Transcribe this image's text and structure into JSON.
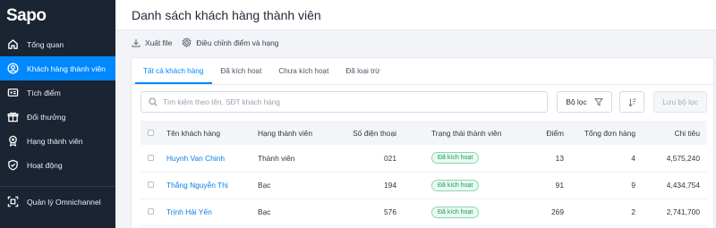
{
  "logo": {
    "text": "Sapo"
  },
  "sidebar": {
    "items": [
      {
        "label": "Tổng quan",
        "icon": "home-icon",
        "active": false
      },
      {
        "label": "Khách hàng thành viên",
        "icon": "user-circle-icon",
        "active": true
      },
      {
        "label": "Tích điểm",
        "icon": "card-icon",
        "active": false
      },
      {
        "label": "Đổi thưởng",
        "icon": "gift-icon",
        "active": false
      },
      {
        "label": "Hạng thành viên",
        "icon": "medal-icon",
        "active": false
      },
      {
        "label": "Hoạt động",
        "icon": "shield-icon",
        "active": false
      }
    ],
    "bottom_item": {
      "label": "Quản lý Omnichannel",
      "icon": "omnichannel-icon"
    }
  },
  "header": {
    "title": "Danh sách khách hàng thành viên"
  },
  "actions": {
    "export_label": "Xuất file",
    "adjust_label": "Điều chỉnh điểm và hạng"
  },
  "tabs": [
    {
      "label": "Tất cả khách hàng",
      "active": true
    },
    {
      "label": "Đã kích hoạt",
      "active": false
    },
    {
      "label": "Chưa kích hoạt",
      "active": false
    },
    {
      "label": "Đã loại trừ",
      "active": false
    }
  ],
  "search": {
    "placeholder": "Tìm kiếm theo tên, SĐT khách hàng"
  },
  "filter": {
    "label": "Bộ lọc"
  },
  "save_filter": {
    "label": "Lưu bộ lọc"
  },
  "table": {
    "headers": {
      "name": "Tên khách hàng",
      "rank": "Hạng thành viên",
      "phone": "Số điện thoại",
      "status": "Trạng thái thành viên",
      "points": "Điểm",
      "orders": "Tổng đơn hàng",
      "spend": "Chi tiêu"
    },
    "rows": [
      {
        "name": "Huynh Van Chinh",
        "rank": "Thành viên",
        "phone": "021",
        "status": "Đã kích hoạt",
        "points": "13",
        "orders": "4",
        "spend": "4,575,240"
      },
      {
        "name": "Thắng Nguyễn Thị",
        "rank": "Bạc",
        "phone": "194",
        "status": "Đã kích hoạt",
        "points": "91",
        "orders": "9",
        "spend": "4,434,754"
      },
      {
        "name": "Trịnh Hải Yến",
        "rank": "Bạc",
        "phone": "576",
        "status": "Đã kích hoạt",
        "points": "269",
        "orders": "2",
        "spend": "2,741,700"
      }
    ]
  },
  "colors": {
    "sidebar_bg": "#1b2433",
    "accent": "#0088ff",
    "badge_green": "#1a9a57"
  }
}
